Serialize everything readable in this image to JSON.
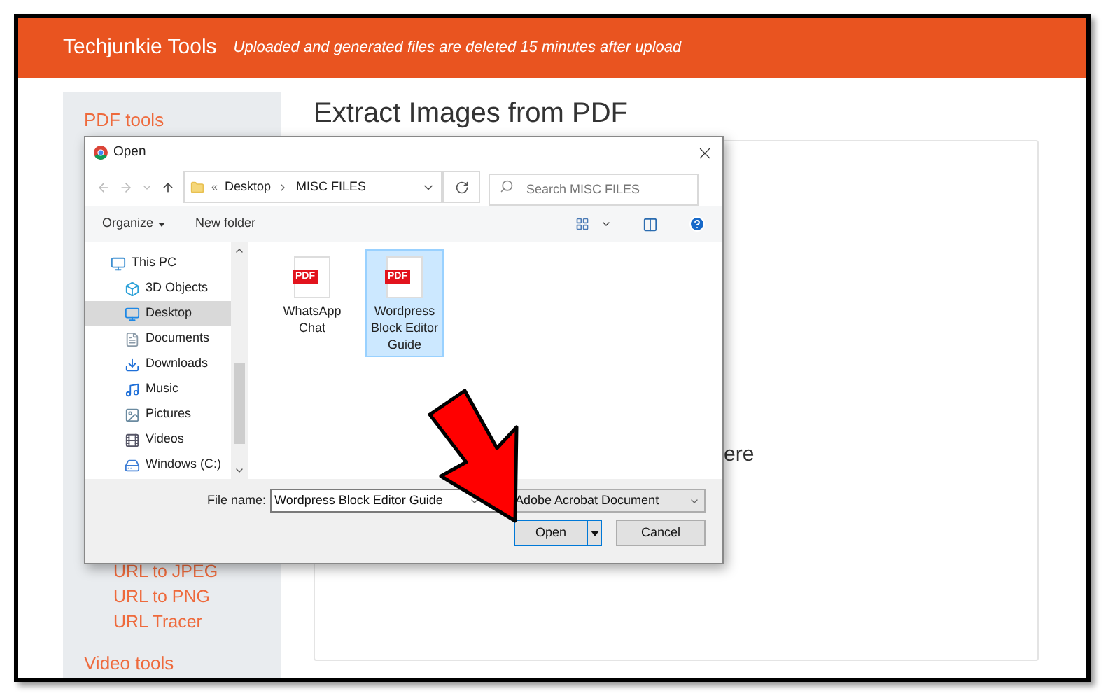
{
  "header": {
    "title": "Techjunkie Tools",
    "notice": "Uploaded and generated files are deleted 15 minutes after upload"
  },
  "sidebar": {
    "items": [
      {
        "kind": "section",
        "label": "PDF tools"
      },
      {
        "kind": "link",
        "label": "URL to JPEG"
      },
      {
        "kind": "link",
        "label": "URL to PNG"
      },
      {
        "kind": "link",
        "label": "URL Tracer"
      },
      {
        "kind": "section",
        "label": "Video tools"
      }
    ]
  },
  "main": {
    "title": "Extract Images from PDF",
    "drop_text": "ere"
  },
  "dialog": {
    "title": "Open",
    "path": {
      "overflow": "«",
      "crumbs": [
        "Desktop",
        "MISC FILES"
      ]
    },
    "search": {
      "placeholder": "Search MISC FILES"
    },
    "toolbar": {
      "organize": "Organize",
      "new_folder": "New folder"
    },
    "nav_pane": [
      {
        "label": "This PC",
        "selected": false,
        "children": [
          {
            "label": "3D Objects",
            "selected": false
          },
          {
            "label": "Desktop",
            "selected": true
          },
          {
            "label": "Documents",
            "selected": false
          },
          {
            "label": "Downloads",
            "selected": false
          },
          {
            "label": "Music",
            "selected": false
          },
          {
            "label": "Pictures",
            "selected": false
          },
          {
            "label": "Videos",
            "selected": false
          },
          {
            "label": "Windows (C:)",
            "selected": false
          }
        ]
      }
    ],
    "files": [
      {
        "name": "WhatsApp Chat",
        "badge": "PDF",
        "selected": false
      },
      {
        "name": "Wordpress Block Editor Guide",
        "badge": "PDF",
        "selected": true
      }
    ],
    "file_name_label": "File name:",
    "file_name": "Wordpress Block Editor Guide",
    "file_type": "Adobe Acrobat Document",
    "buttons": {
      "open": "Open",
      "cancel": "Cancel"
    }
  }
}
